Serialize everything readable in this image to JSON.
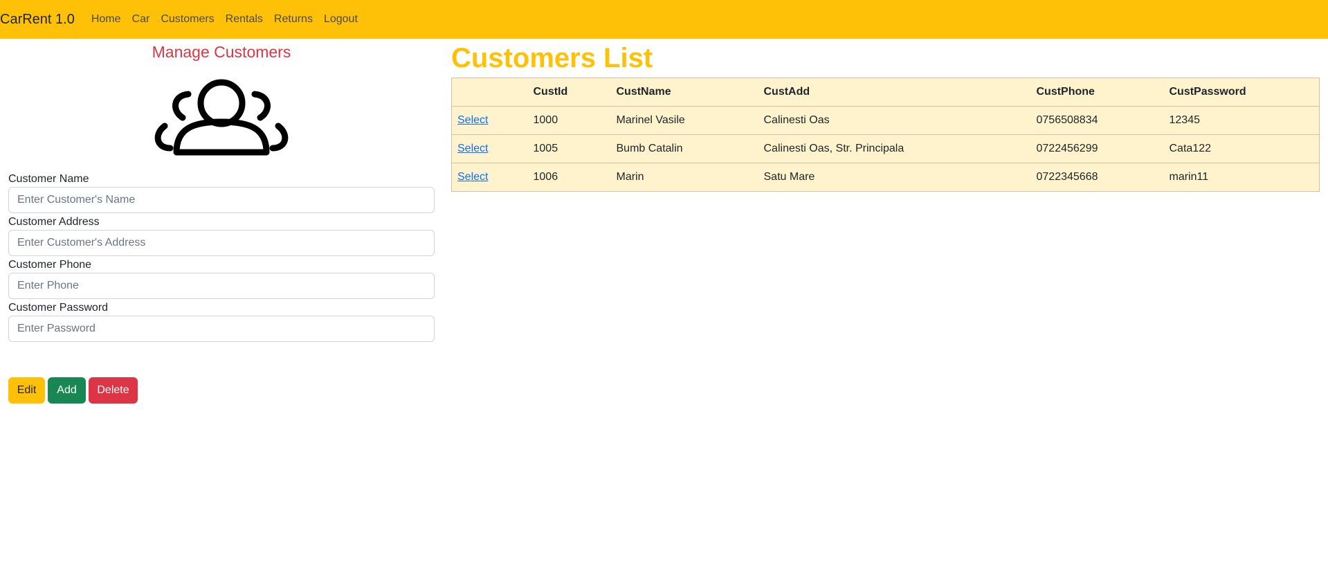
{
  "navbar": {
    "brand": "CarRent 1.0",
    "links": [
      "Home",
      "Car",
      "Customers",
      "Rentals",
      "Returns",
      "Logout"
    ],
    "bg_color": "#ffc107"
  },
  "manage": {
    "title": "Manage Customers",
    "icon": "people-group-icon",
    "fields": [
      {
        "label": "Customer Name",
        "placeholder": "Enter Customer's Name",
        "value": ""
      },
      {
        "label": "Customer Address",
        "placeholder": "Enter Customer's Address",
        "value": ""
      },
      {
        "label": "Customer Phone",
        "placeholder": "Enter Phone",
        "value": ""
      },
      {
        "label": "Customer Password",
        "placeholder": "Enter Password",
        "value": ""
      }
    ],
    "buttons": {
      "edit": "Edit",
      "add": "Add",
      "delete": "Delete"
    }
  },
  "list": {
    "title": "Customers List",
    "columns": [
      "",
      "CustId",
      "CustName",
      "CustAdd",
      "CustPhone",
      "CustPassword"
    ],
    "rows": [
      {
        "select": "Select",
        "id": "1000",
        "name": "Marinel Vasile",
        "address": "Calinesti Oas",
        "phone": "0756508834",
        "password": "12345"
      },
      {
        "select": "Select",
        "id": "1005",
        "name": "Bumb Catalin",
        "address": "Calinesti Oas, Str. Principala",
        "phone": "0722456299",
        "password": "Cata122"
      },
      {
        "select": "Select",
        "id": "1006",
        "name": "Marin",
        "address": "Satu Mare",
        "phone": "0722345668",
        "password": "marin11"
      }
    ]
  },
  "colors": {
    "accent": "#ffc107",
    "danger": "#dc3545",
    "success": "#198754",
    "table_bg": "#fff3cd",
    "link": "#0d6efd"
  }
}
